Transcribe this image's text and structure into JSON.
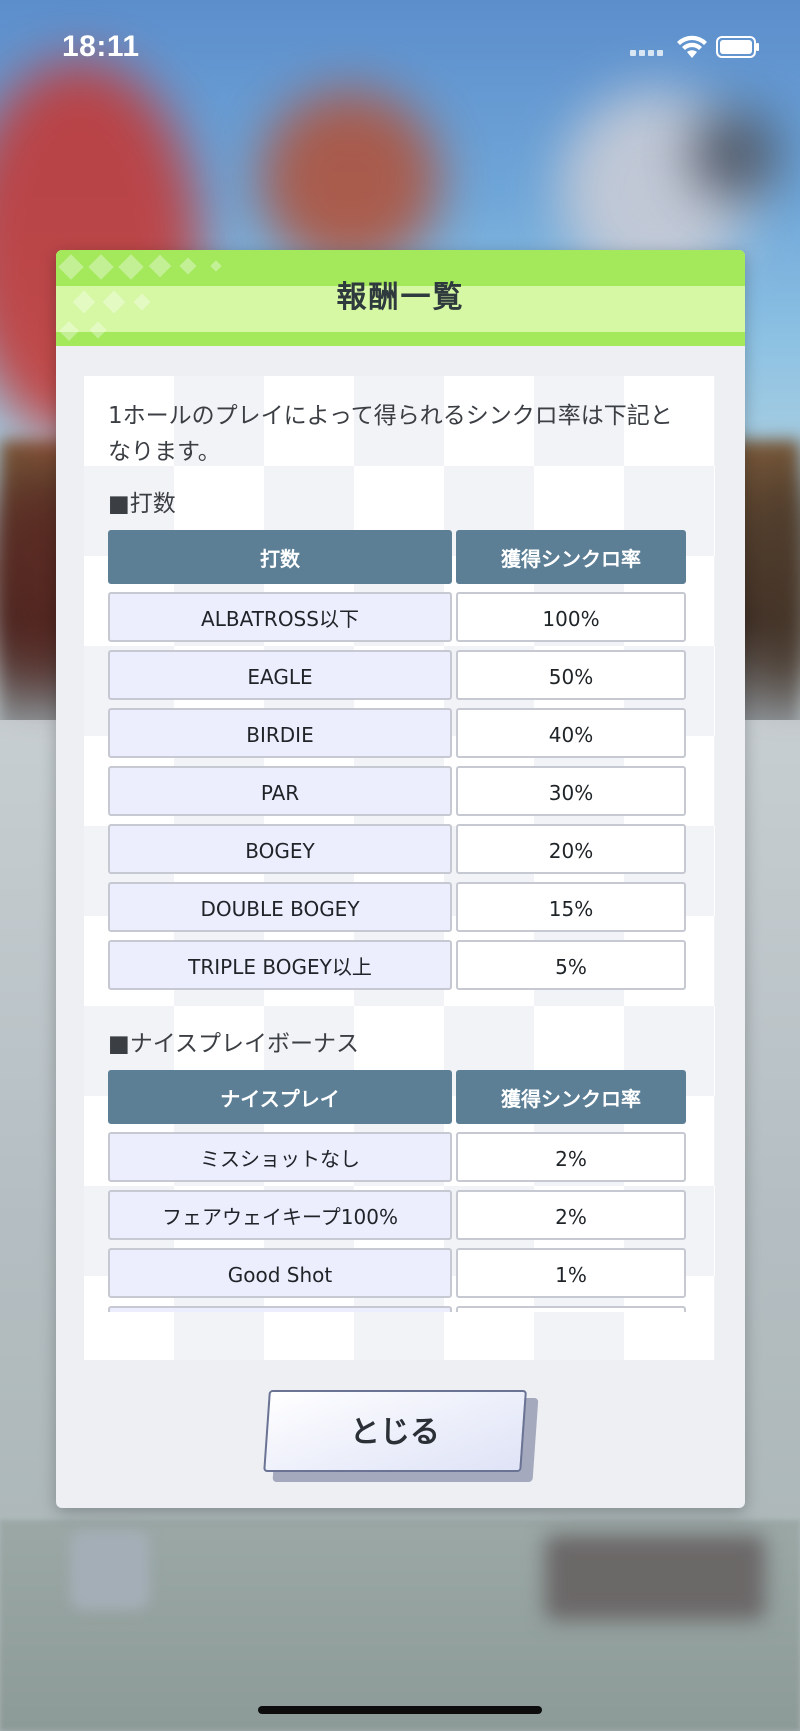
{
  "status_bar": {
    "time": "18:11"
  },
  "modal": {
    "title": "報酬一覧",
    "intro": "1ホールのプレイによって得られるシンクロ率は下記となります。",
    "sections": [
      {
        "title": "■打数",
        "header": [
          "打数",
          "獲得シンクロ率"
        ],
        "rows": [
          [
            "ALBATROSS以下",
            "100%"
          ],
          [
            "EAGLE",
            "50%"
          ],
          [
            "BIRDIE",
            "40%"
          ],
          [
            "PAR",
            "30%"
          ],
          [
            "BOGEY",
            "20%"
          ],
          [
            "DOUBLE BOGEY",
            "15%"
          ],
          [
            "TRIPLE BOGEY以上",
            "5%"
          ]
        ]
      },
      {
        "title": "■ナイスプレイボーナス",
        "header": [
          "ナイスプレイ",
          "獲得シンクロ率"
        ],
        "rows": [
          [
            "ミスショットなし",
            "2%"
          ],
          [
            "フェアウェイキープ100%",
            "2%"
          ],
          [
            "Good Shot",
            "1%"
          ]
        ]
      }
    ],
    "close_label": "とじる"
  },
  "colors": {
    "header_green": "#b4f06a",
    "table_header": "#5c7f96",
    "row_label_bg": "#ecedfd"
  }
}
